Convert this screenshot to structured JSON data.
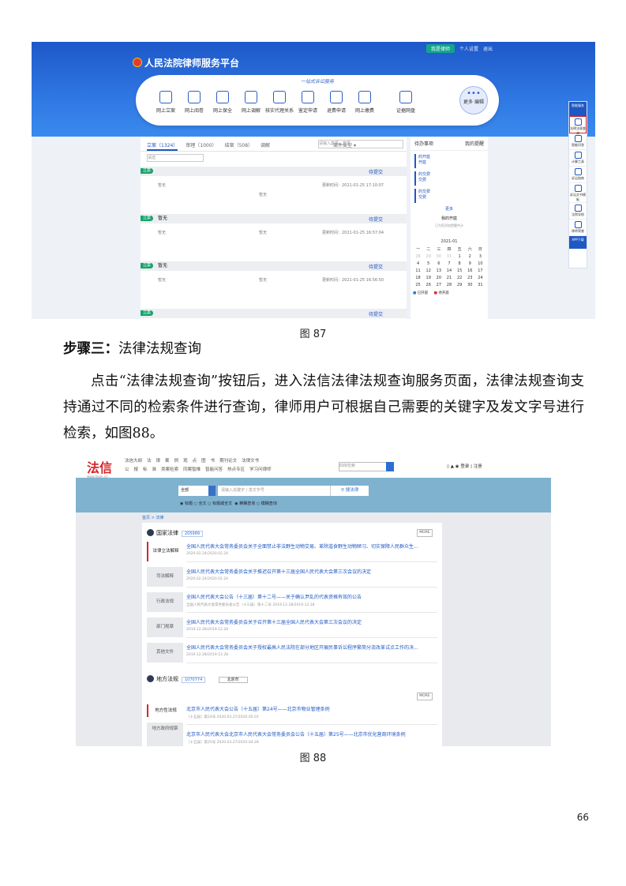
{
  "fig87": {
    "caption": "图 87",
    "platform_title": "人民法院律师服务平台",
    "top_bar": {
      "role_select": "我是律师",
      "personal_center": "个人设置",
      "logout": "退出"
    },
    "slogan": "一站式诉讼服务",
    "nav_items": [
      "网上立案",
      "网上阅卷",
      "网上保全",
      "网上调解",
      "核实代理关系",
      "鉴定申请",
      "退费申请",
      "网上缴费",
      "证据网盘"
    ],
    "nav_more": "更多 编辑",
    "tabs": [
      "立案（1324）",
      "审理（1000）",
      "结案（508）",
      "调解"
    ],
    "filter_placeholder": "请选",
    "sort_label": "案件类型 ▾",
    "search_placeholder": "请输入案号、案号",
    "cases": [
      {
        "tag": "立案",
        "title": "",
        "submit": "待提交",
        "field1": "暂无",
        "field2": "暂无",
        "time": "更新时间：2021-01-25 17:10:07"
      },
      {
        "tag": "立案",
        "title": "暂无",
        "submit": "待提交",
        "field1": "暂无",
        "field2": "暂无",
        "time": "更新时间：2021-01-25 16:57:04"
      },
      {
        "tag": "立案",
        "title": "暂无",
        "submit": "待提交",
        "field1": "暂无",
        "field2": "暂无",
        "time": "更新时间：2021-01-25 16:56:50"
      },
      {
        "tag": "立案",
        "title": "",
        "submit": "待提交"
      }
    ],
    "todo": {
      "title": "待办事项",
      "check": "我的提醒",
      "items": [
        "的开庭",
        "的交费",
        "的交费"
      ],
      "item_labels": [
        "开庭",
        "交费",
        "交费"
      ],
      "more": "更多",
      "my_hearing": "我的开庭",
      "no_hearing_note": "已为您添加提醒共计",
      "calendar_month": "2021-01",
      "weekdays": [
        "一",
        "二",
        "三",
        "四",
        "五",
        "六",
        "日"
      ],
      "days": [
        "28",
        "29",
        "30",
        "31",
        "1",
        "2",
        "3",
        "4",
        "5",
        "6",
        "7",
        "8",
        "9",
        "10",
        "11",
        "12",
        "13",
        "14",
        "15",
        "16",
        "17",
        "18",
        "19",
        "20",
        "21",
        "22",
        "23",
        "24",
        "25",
        "26",
        "27",
        "28",
        "29",
        "30",
        "31"
      ],
      "legend": [
        "已开庭",
        "待开庭"
      ]
    },
    "sidebar": {
      "top": "智能服务",
      "items": [
        "法律法规查询",
        "智能问答",
        "计算工具",
        "诉讼指南",
        "诉讼文书模板",
        "法院导航",
        "律师荣誉"
      ],
      "bottom": "APP下载"
    }
  },
  "heading": {
    "step": "步骤三：",
    "title": "法律法规查询"
  },
  "paragraph": "点击“法律法规查询”按钮后，进入法信法律法规查询服务页面，法律法规查询支持通过不同的检索条件进行查询，律师用户可根据自己需要的关键字及发文字号进行检索，如图88。",
  "fig88": {
    "caption": "图 88",
    "brand": "法信",
    "brand_url": "www.faxin.cn",
    "menu_row1": [
      "法信大纲",
      "法",
      "律",
      "案",
      "例",
      "观",
      "点",
      "图",
      "书",
      "期刊论文",
      "法律文书"
    ],
    "menu_row2": [
      "公",
      "报",
      "标",
      "准",
      "类案检索",
      "同案智推",
      "智能问答",
      "热点专区",
      "学习问律师"
    ],
    "header_search_placeholder": "四库检索",
    "header_user": [
      "登录",
      "注册"
    ],
    "scope_select": "全部",
    "keyword_placeholder": "请输入关键字 / 发文字号",
    "search_button": "搜法律",
    "radio_options": [
      "标题",
      "全文",
      "标题或全文",
      "精确查询",
      "模糊查询"
    ],
    "breadcrumb": "首页 > 法律",
    "national": {
      "label": "国家法律",
      "count": "205989",
      "more": "MORE",
      "categories": [
        "法律立法解释",
        "司法解释",
        "行政法规",
        "部门规章",
        "其他文件"
      ],
      "rows": [
        {
          "title": "全国人民代表大会常务委员会关于全面禁止非法野生动物交易、革除滥食野生动物陋习、切实保障人民群众生...",
          "date": "2020.02.24/2020.02.24"
        },
        {
          "title": "全国人民代表大会常务委员会关于推迟召开第十三届全国人民代表大会第三次会议的决定",
          "date": "2020.02.24/2020.02.24"
        },
        {
          "title": "全国人民代表大会公告（十三届）第十二号——关于确认尹乱的代表资格有效的公告",
          "date": "全国人民代表大会常务委员会公告（十三届）第十二号 2019.12.28/2019.12.28"
        },
        {
          "title": "全国人民代表大会常务委员会关于召开第十三届全国人民代表大会第三次会议的决定",
          "date": "2019.12.28/2019.12.28"
        },
        {
          "title": "全国人民代表大会常务委员会关于授权最高人民法院在部分地区开展民事诉讼程序繁简分流改革试点工作的决...",
          "date": "2019.12.28/2019.12.28"
        }
      ]
    },
    "local": {
      "label": "地方法规",
      "count": "1070774",
      "location": "北京市",
      "more": "MORE",
      "categories": [
        "地方性法规",
        "地方政府规章"
      ],
      "rows": [
        {
          "title": "北京市人民代表大会公告〔十五届〕第24号——北京市物业管理条例",
          "date": "〔十五届〕第24号 2020.03.27/2020.05.01"
        },
        {
          "title": "北京市人民代表大会北京市人民代表大会常务委员会公告〔十五届〕第25号——北京市优化营商环境条例",
          "date": "〔十五届〕第25号 2020.03.27/2020.04.28"
        }
      ]
    }
  },
  "page_number": "66"
}
